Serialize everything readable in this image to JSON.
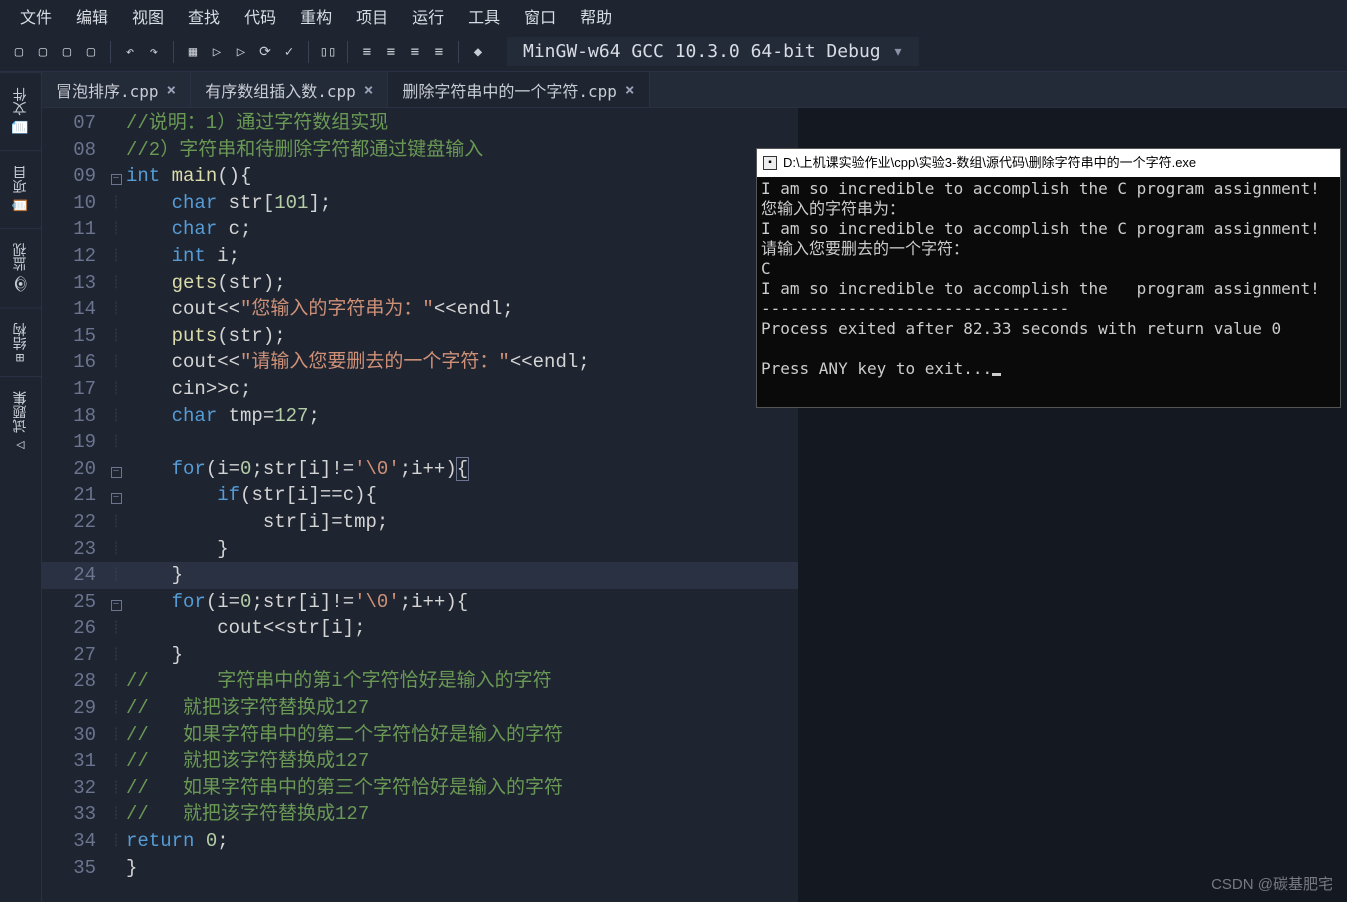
{
  "menubar": [
    "文件",
    "编辑",
    "视图",
    "查找",
    "代码",
    "重构",
    "项目",
    "运行",
    "工具",
    "窗口",
    "帮助"
  ],
  "toolbar": {
    "icons": [
      "new-file-icon",
      "open-file-icon",
      "save-icon",
      "save-all-icon",
      "",
      "undo-icon",
      "redo-icon",
      "",
      "grid-icon",
      "run-icon",
      "build-run-icon",
      "rebuild-icon",
      "debug-icon",
      "",
      "stop-icon",
      "",
      "step-over-icon",
      "step-into-icon",
      "step-out-icon",
      "continue-icon",
      "",
      "breakpoint-icon"
    ],
    "compiler": "MinGW-w64 GCC 10.3.0 64-bit Debug"
  },
  "side_tabs": [
    {
      "icon": "📄",
      "label": "文件"
    },
    {
      "icon": "📋",
      "label": "项目"
    },
    {
      "icon": "👁",
      "label": "监视"
    },
    {
      "icon": "⊞",
      "label": "结构"
    },
    {
      "icon": "△",
      "label": "试题集"
    }
  ],
  "file_tabs": [
    {
      "label": "冒泡排序.cpp",
      "active": false
    },
    {
      "label": "有序数组插入数.cpp",
      "active": false
    },
    {
      "label": "删除字符串中的一个字符.cpp",
      "active": true
    }
  ],
  "code": [
    {
      "n": "07",
      "fold": "",
      "html": "<span class='c-cmt'>//说明：1）通过字符数组实现</span>"
    },
    {
      "n": "08",
      "fold": "",
      "html": "<span class='c-cmt'>//2）字符串和待删除字符都通过键盘输入</span>"
    },
    {
      "n": "09",
      "fold": "-",
      "html": "<span class='c-type'>int</span> <span class='c-fn'>main</span><span class='c-punc'>(){</span>"
    },
    {
      "n": "10",
      "fold": "|",
      "html": "    <span class='c-type'>char</span> <span class='c-id'>str</span><span class='c-punc'>[</span><span class='c-num'>101</span><span class='c-punc'>];</span>"
    },
    {
      "n": "11",
      "fold": "|",
      "html": "    <span class='c-type'>char</span> <span class='c-id'>c</span><span class='c-punc'>;</span>"
    },
    {
      "n": "12",
      "fold": "|",
      "html": "    <span class='c-type'>int</span> <span class='c-id'>i</span><span class='c-punc'>;</span>"
    },
    {
      "n": "13",
      "fold": "|",
      "html": "    <span class='c-fn2'>gets</span><span class='c-punc'>(</span><span class='c-id'>str</span><span class='c-punc'>);</span>"
    },
    {
      "n": "14",
      "fold": "|",
      "html": "    <span class='c-id'>cout</span><span class='c-op'>&lt;&lt;</span><span class='c-str'>\"您输入的字符串为：\"</span><span class='c-op'>&lt;&lt;</span><span class='c-id'>endl</span><span class='c-punc'>;</span>"
    },
    {
      "n": "15",
      "fold": "|",
      "html": "    <span class='c-fn2'>puts</span><span class='c-punc'>(</span><span class='c-id'>str</span><span class='c-punc'>);</span>"
    },
    {
      "n": "16",
      "fold": "|",
      "html": "    <span class='c-id'>cout</span><span class='c-op'>&lt;&lt;</span><span class='c-str'>\"请输入您要删去的一个字符：\"</span><span class='c-op'>&lt;&lt;</span><span class='c-id'>endl</span><span class='c-punc'>;</span>"
    },
    {
      "n": "17",
      "fold": "|",
      "html": "    <span class='c-id'>cin</span><span class='c-op'>&gt;&gt;</span><span class='c-id'>c</span><span class='c-punc'>;</span>"
    },
    {
      "n": "18",
      "fold": "|",
      "html": "    <span class='c-type'>char</span> <span class='c-id'>tmp</span><span class='c-op'>=</span><span class='c-num'>127</span><span class='c-punc'>;</span>"
    },
    {
      "n": "19",
      "fold": "|",
      "html": ""
    },
    {
      "n": "20",
      "fold": "-",
      "html": "    <span class='c-kw'>for</span><span class='c-punc'>(</span><span class='c-id'>i</span><span class='c-op'>=</span><span class='c-num'>0</span><span class='c-punc'>;</span><span class='c-id'>str</span><span class='c-punc'>[</span><span class='c-id'>i</span><span class='c-punc'>]</span><span class='c-op'>!=</span><span class='c-str'>'\\0'</span><span class='c-punc'>;</span><span class='c-id'>i</span><span class='c-op'>++</span><span class='c-punc'>)</span><span class='c-punc cursor-box'>{</span>"
    },
    {
      "n": "21",
      "fold": "-",
      "html": "        <span class='c-kw'>if</span><span class='c-punc'>(</span><span class='c-id'>str</span><span class='c-punc'>[</span><span class='c-id'>i</span><span class='c-punc'>]</span><span class='c-op'>==</span><span class='c-id'>c</span><span class='c-punc'>){</span>"
    },
    {
      "n": "22",
      "fold": "|",
      "html": "            <span class='c-id'>str</span><span class='c-punc'>[</span><span class='c-id'>i</span><span class='c-punc'>]</span><span class='c-op'>=</span><span class='c-id'>tmp</span><span class='c-punc'>;</span>"
    },
    {
      "n": "23",
      "fold": "|",
      "html": "        <span class='c-punc'>}</span>"
    },
    {
      "n": "24",
      "fold": "|",
      "hl": true,
      "html": "    <span class='c-punc'>}</span>"
    },
    {
      "n": "25",
      "fold": "-",
      "html": "    <span class='c-kw'>for</span><span class='c-punc'>(</span><span class='c-id'>i</span><span class='c-op'>=</span><span class='c-num'>0</span><span class='c-punc'>;</span><span class='c-id'>str</span><span class='c-punc'>[</span><span class='c-id'>i</span><span class='c-punc'>]</span><span class='c-op'>!=</span><span class='c-str'>'\\0'</span><span class='c-punc'>;</span><span class='c-id'>i</span><span class='c-op'>++</span><span class='c-punc'>){</span>"
    },
    {
      "n": "26",
      "fold": "|",
      "html": "        <span class='c-id'>cout</span><span class='c-op'>&lt;&lt;</span><span class='c-id'>str</span><span class='c-punc'>[</span><span class='c-id'>i</span><span class='c-punc'>];</span>"
    },
    {
      "n": "27",
      "fold": "|",
      "html": "    <span class='c-punc'>}</span>"
    },
    {
      "n": "28",
      "fold": "|",
      "html": "<span class='c-cmt'>//      字符串中的第i个字符恰好是输入的字符</span>"
    },
    {
      "n": "29",
      "fold": "|",
      "html": "<span class='c-cmt'>//   就把该字符替换成127</span>"
    },
    {
      "n": "30",
      "fold": "|",
      "html": "<span class='c-cmt'>//   如果字符串中的第二个字符恰好是输入的字符</span>"
    },
    {
      "n": "31",
      "fold": "|",
      "html": "<span class='c-cmt'>//   就把该字符替换成127</span>"
    },
    {
      "n": "32",
      "fold": "|",
      "html": "<span class='c-cmt'>//   如果字符串中的第三个字符恰好是输入的字符</span>"
    },
    {
      "n": "33",
      "fold": "|",
      "html": "<span class='c-cmt'>//   就把该字符替换成127</span>"
    },
    {
      "n": "34",
      "fold": "|",
      "html": "<span class='c-kw'>return</span> <span class='c-num'>0</span><span class='c-punc'>;</span>"
    },
    {
      "n": "35",
      "fold": "",
      "html": "<span class='c-punc'>}</span>"
    }
  ],
  "console": {
    "title": "D:\\上机课实验作业\\cpp\\实验3-数组\\源代码\\删除字符串中的一个字符.exe",
    "lines": [
      "I am so incredible to accomplish the C program assignment!",
      "您输入的字符串为：",
      "I am so incredible to accomplish the C program assignment!",
      "请输入您要删去的一个字符：",
      "C",
      "I am so incredible to accomplish the   program assignment!",
      "--------------------------------",
      "Process exited after 82.33 seconds with return value 0",
      "",
      "Press ANY key to exit..."
    ]
  },
  "watermark": "CSDN @碳基肥宅"
}
